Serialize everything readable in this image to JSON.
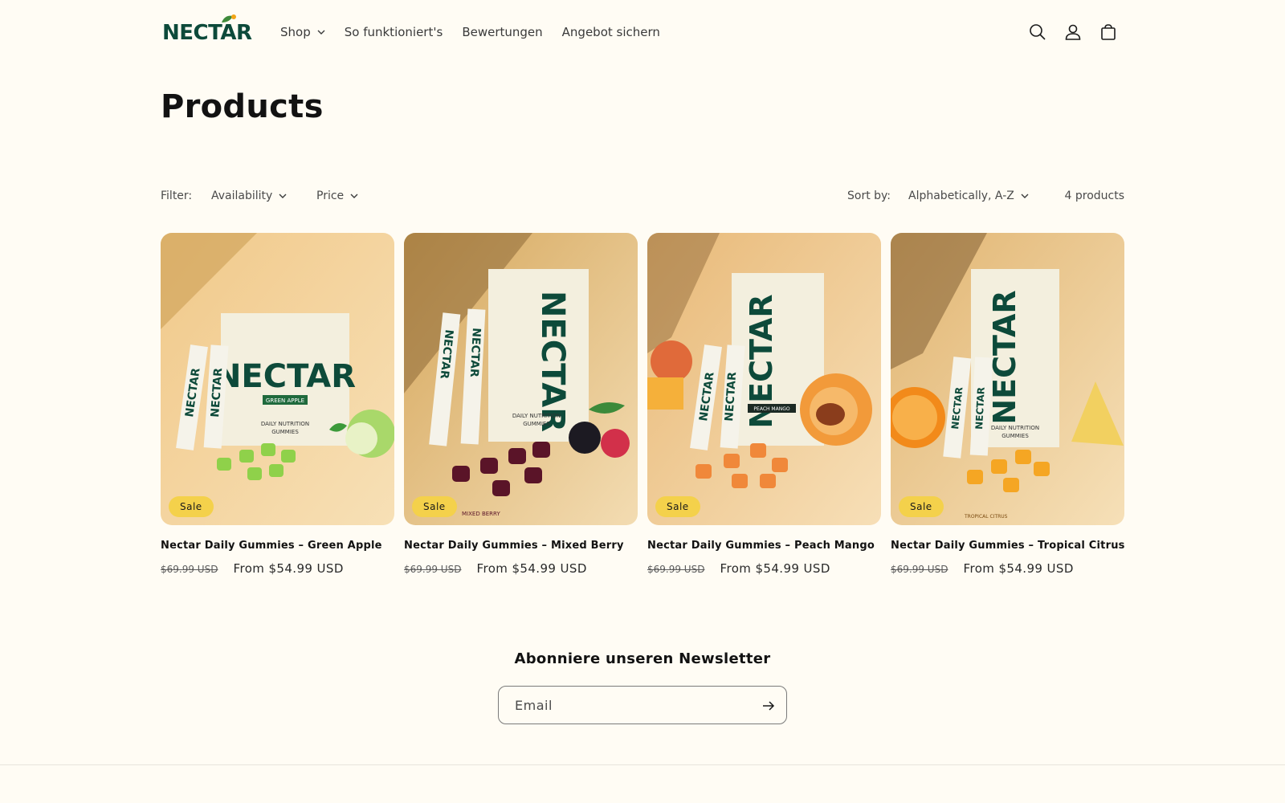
{
  "header": {
    "logo_text": "NECTAR",
    "nav": [
      {
        "label": "Shop",
        "has_dropdown": true
      },
      {
        "label": "So funktioniert's",
        "has_dropdown": false
      },
      {
        "label": "Bewertungen",
        "has_dropdown": false
      },
      {
        "label": "Angebot sichern",
        "has_dropdown": false
      }
    ],
    "icons": [
      "search-icon",
      "account-icon",
      "cart-icon"
    ]
  },
  "page": {
    "title": "Products"
  },
  "filters": {
    "filter_label": "Filter:",
    "availability_label": "Availability",
    "price_label": "Price",
    "sort_label": "Sort by:",
    "sort_value": "Alphabetically, A-Z",
    "count": "4 products"
  },
  "products": [
    {
      "title": "Nectar Daily Gummies – Green Apple",
      "badge": "Sale",
      "old_price": "$69.99 USD",
      "price": "From $54.99 USD",
      "pack_flavor": "GREEN APPLE",
      "accent": "#8fd14a"
    },
    {
      "title": "Nectar Daily Gummies – Mixed Berry",
      "badge": "Sale",
      "old_price": "$69.99 USD",
      "price": "From $54.99 USD",
      "pack_flavor": "MIXED BERRY",
      "accent": "#5a1428"
    },
    {
      "title": "Nectar Daily Gummies – Peach Mango",
      "badge": "Sale",
      "old_price": "$69.99 USD",
      "price": "From $54.99 USD",
      "pack_flavor": "PEACH MANGO",
      "accent": "#f0883a"
    },
    {
      "title": "Nectar Daily Gummies – Tropical Citrus",
      "badge": "Sale",
      "old_price": "$69.99 USD",
      "price": "From $54.99 USD",
      "pack_flavor": "TROPICAL CITRUS",
      "accent": "#f5a623"
    }
  ],
  "newsletter": {
    "title": "Abonniere unseren Newsletter",
    "placeholder": "Email"
  },
  "colors": {
    "background": "#fffcf4",
    "brand_green": "#0d4a3a",
    "sale_badge": "#f4d14b"
  }
}
